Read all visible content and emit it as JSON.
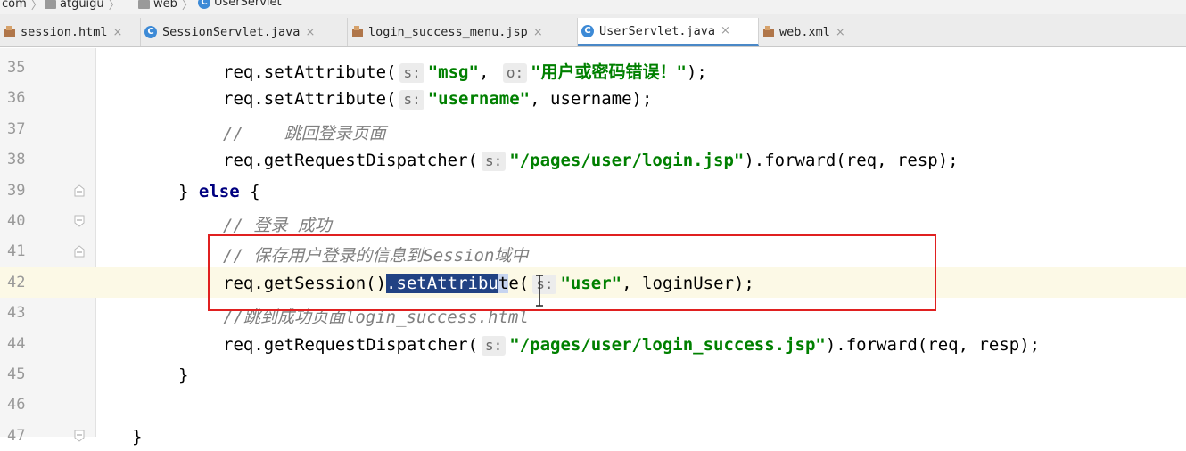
{
  "breadcrumb": {
    "items": [
      {
        "label": "com",
        "icon": "folder-icon"
      },
      {
        "label": "atguigu",
        "icon": "folder-icon"
      },
      {
        "label": "web",
        "icon": "folder-icon"
      },
      {
        "label": "UserServlet",
        "icon": "class-icon"
      }
    ]
  },
  "tabs": [
    {
      "label": "session.html",
      "icon": "html-file-icon",
      "active": false
    },
    {
      "label": "SessionServlet.java",
      "icon": "class-icon",
      "active": false
    },
    {
      "label": "login_success_menu.jsp",
      "icon": "jsp-file-icon",
      "active": false
    },
    {
      "label": "UserServlet.java",
      "icon": "class-icon",
      "active": true
    },
    {
      "label": "web.xml",
      "icon": "xml-file-icon",
      "active": false
    }
  ],
  "tab_close_glyph": "×",
  "editor": {
    "current_line": 42,
    "lines": [
      {
        "n": "35",
        "tokens": [
          [
            "",
            "req.setAttribute("
          ],
          [
            "hint",
            "s:"
          ],
          [
            "str",
            "\"msg\""
          ],
          [
            "",
            ", "
          ],
          [
            "hint",
            "o:"
          ],
          [
            "str",
            "\"用户或密码错误！\""
          ],
          [
            "",
            ");"
          ]
        ]
      },
      {
        "n": "36",
        "tokens": [
          [
            "",
            "req.setAttribute("
          ],
          [
            "hint",
            "s:"
          ],
          [
            "str",
            "\"username\""
          ],
          [
            "",
            ", username);"
          ]
        ]
      },
      {
        "n": "37",
        "tokens": [
          [
            "cmt",
            "//    跳回登录页面"
          ]
        ]
      },
      {
        "n": "38",
        "tokens": [
          [
            "",
            "req.getRequestDispatcher("
          ],
          [
            "hint",
            "s:"
          ],
          [
            "str",
            "\"/pages/user/login.jsp\""
          ],
          [
            "",
            ").forward(req, resp);"
          ]
        ]
      },
      {
        "n": "39",
        "tokens": [
          [
            "",
            "} "
          ],
          [
            "kw",
            "else"
          ],
          [
            "",
            " {"
          ]
        ]
      },
      {
        "n": "40",
        "tokens": [
          [
            "cmt",
            "// 登录 成功"
          ]
        ]
      },
      {
        "n": "41",
        "tokens": [
          [
            "cmt",
            "// 保存用户登录的信息到Session域中"
          ]
        ]
      },
      {
        "n": "42",
        "tokens": [
          [
            "",
            "req.getSession()"
          ],
          [
            "sel",
            ".setAttribu"
          ],
          [
            "sel2",
            "t"
          ],
          [
            "",
            "e("
          ],
          [
            "hint",
            "s:"
          ],
          [
            "str",
            "\"user\""
          ],
          [
            "",
            ", loginUser);"
          ]
        ]
      },
      {
        "n": "43",
        "tokens": [
          [
            "cmt",
            "//跳到成功页面login_success.html"
          ]
        ]
      },
      {
        "n": "44",
        "tokens": [
          [
            "",
            "req.getRequestDispatcher("
          ],
          [
            "hint",
            "s:"
          ],
          [
            "str",
            "\"/pages/user/login_success.jsp\""
          ],
          [
            "",
            ").forward(req, resp);"
          ]
        ]
      },
      {
        "n": "45",
        "tokens": [
          [
            "",
            "}"
          ]
        ]
      },
      {
        "n": "46",
        "tokens": []
      },
      {
        "n": "47",
        "tokens": [
          [
            "",
            "}"
          ]
        ]
      }
    ]
  },
  "colors": {
    "keyword": "#000080",
    "string": "#008000",
    "comment": "#808080",
    "selection": "#214283",
    "current_line": "#fcf9e6",
    "annotation_box": "#e02020",
    "active_tab_underline": "#4a88c7"
  }
}
